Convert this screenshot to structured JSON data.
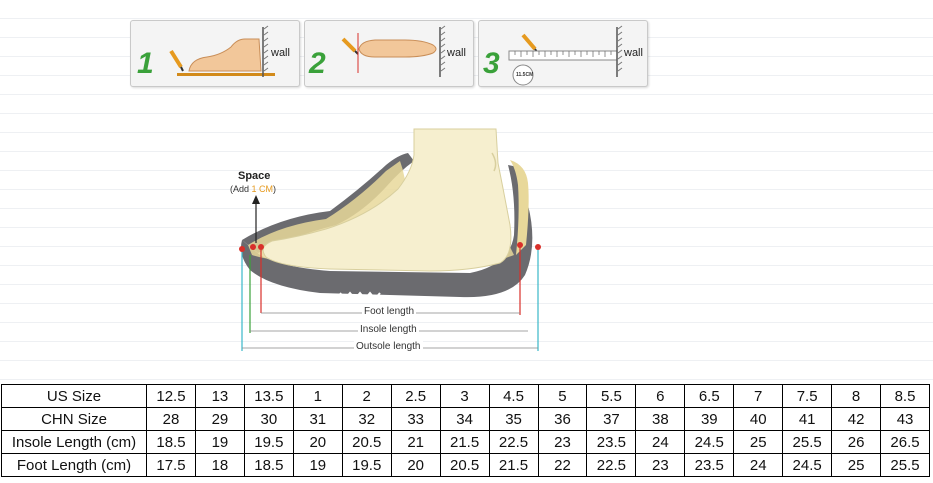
{
  "steps": [
    {
      "number": "1",
      "wall_label": "wall"
    },
    {
      "number": "2",
      "wall_label": "wall"
    },
    {
      "number": "3",
      "wall_label": "wall",
      "measure_label": "11.5CM"
    }
  ],
  "diagram": {
    "space_label": "Space",
    "add_prefix": "(Add ",
    "add_value": "1 CM",
    "add_suffix": ")",
    "foot_length_label": "Foot length",
    "insole_length_label": "Insole length",
    "outsole_length_label": "Outsole length",
    "colors": {
      "accent": "#e69a1f",
      "red": "#d9302a",
      "cyan": "#39b7c9"
    }
  },
  "size_table": {
    "rows": [
      {
        "header": "US Size",
        "cells": [
          "12.5",
          "13",
          "13.5",
          "1",
          "2",
          "2.5",
          "3",
          "4.5",
          "5",
          "5.5",
          "6",
          "6.5",
          "7",
          "7.5",
          "8",
          "8.5"
        ]
      },
      {
        "header": "CHN Size",
        "cells": [
          "28",
          "29",
          "30",
          "31",
          "32",
          "33",
          "34",
          "35",
          "36",
          "37",
          "38",
          "39",
          "40",
          "41",
          "42",
          "43"
        ]
      },
      {
        "header": "Insole Length (cm)",
        "cells": [
          "18.5",
          "19",
          "19.5",
          "20",
          "20.5",
          "21",
          "21.5",
          "22.5",
          "23",
          "23.5",
          "24",
          "24.5",
          "25",
          "25.5",
          "26",
          "26.5"
        ]
      },
      {
        "header": "Foot Length (cm)",
        "cells": [
          "17.5",
          "18",
          "18.5",
          "19",
          "19.5",
          "20",
          "20.5",
          "21.5",
          "22",
          "22.5",
          "23",
          "23.5",
          "24",
          "24.5",
          "25",
          "25.5"
        ]
      }
    ]
  }
}
